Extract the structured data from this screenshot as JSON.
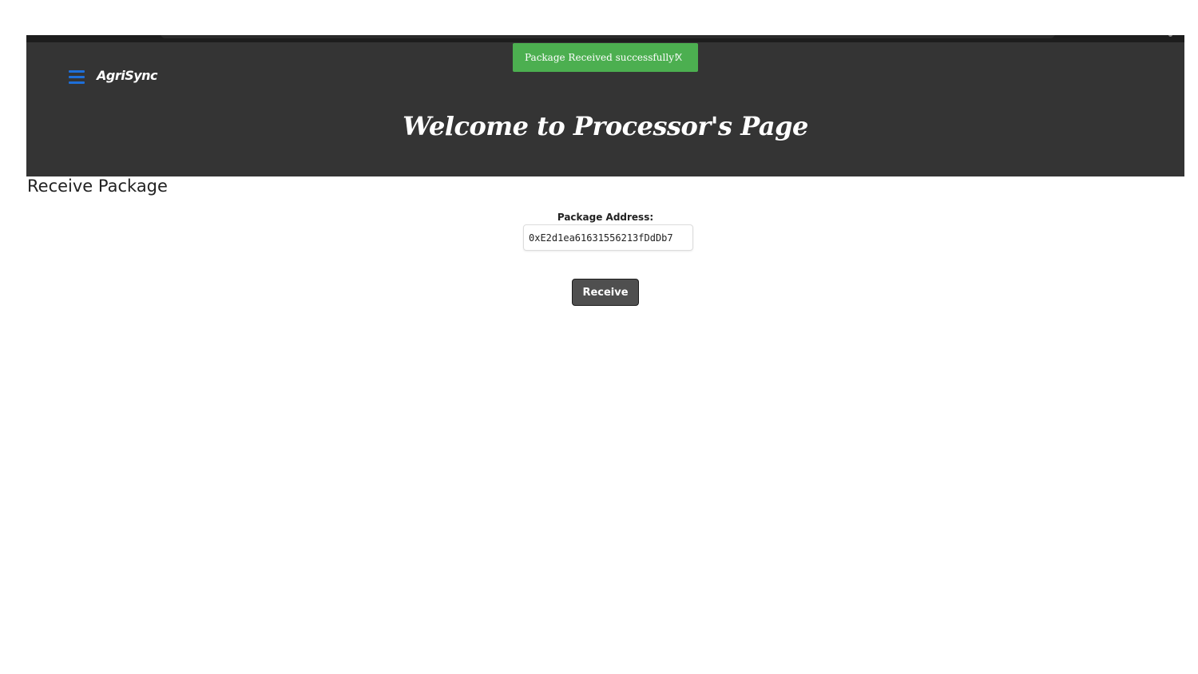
{
  "app": {
    "brand": "AgriSync",
    "welcome_title": "Welcome to Processor's Page"
  },
  "toast": {
    "message": "Package Received successfully!",
    "close_label": "X",
    "color": "#4caf50"
  },
  "main": {
    "section_title": "Receive Package",
    "address_label": "Package Address:",
    "address_value": "0xE2d1ea61631556213fDdDb7",
    "receive_label": "Receive"
  },
  "icons": {
    "menu": "hamburger-menu-icon"
  },
  "colors": {
    "header_bg": "#343434",
    "accent_blue": "#1e6fd9",
    "button_bg": "#4f4f4f"
  }
}
